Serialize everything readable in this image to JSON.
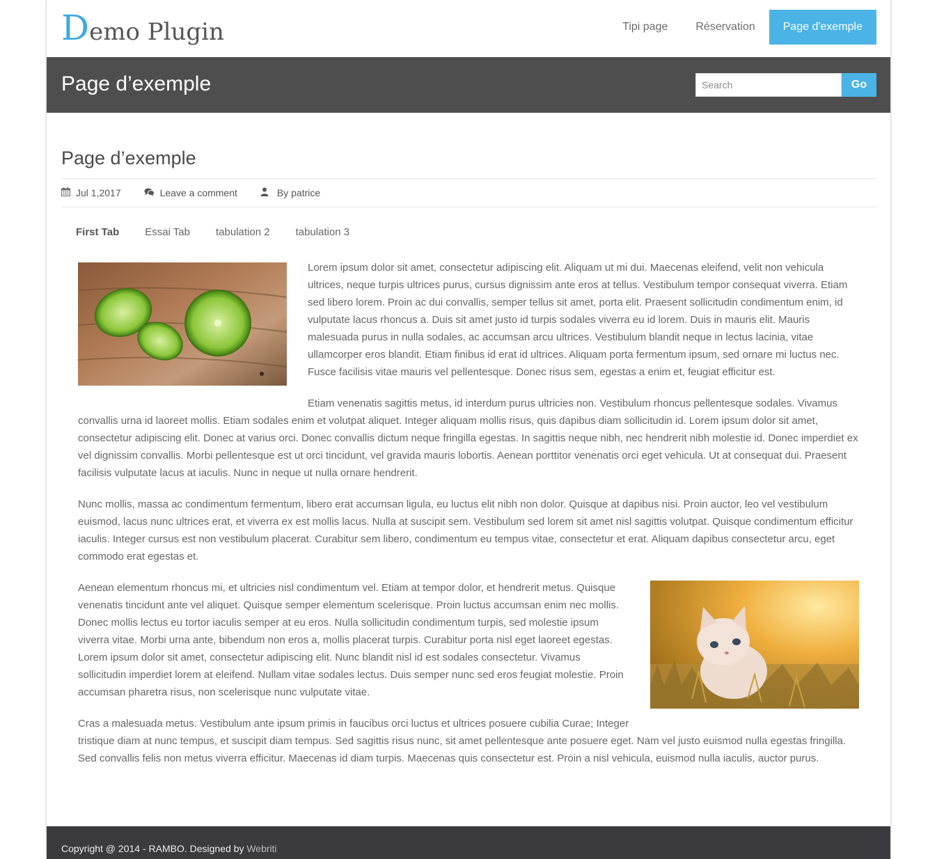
{
  "site": {
    "logo_initial": "D",
    "logo_rest": "emo Plugin",
    "nav": [
      {
        "label": "Tipi page"
      },
      {
        "label": "Réservation"
      },
      {
        "label": "Page d'exemple",
        "active": true
      }
    ]
  },
  "titlebar": {
    "title": "Page d’exemple",
    "search_placeholder": "Search",
    "search_button": "Go"
  },
  "post": {
    "title": "Page d’exemple",
    "date": "Jul 1,2017",
    "comment_link": "Leave a comment",
    "author": "By patrice",
    "tabs": [
      "First Tab",
      "Essai Tab",
      "tabulation 2",
      "tabulation 3"
    ],
    "paragraphs": [
      "Lorem ipsum dolor sit amet, consectetur adipiscing elit. Aliquam ut mi dui. Maecenas eleifend, velit non vehicula ultrices, neque turpis ultrices purus, cursus dignissim ante eros at tellus. Vestibulum tempor consequat viverra. Etiam sed libero lorem. Proin ac dui convallis, semper tellus sit amet, porta elit. Praesent sollicitudin condimentum enim, id vulputate lacus rhoncus a. Duis sit amet justo id turpis sodales viverra eu id lorem. Duis in mauris elit. Mauris malesuada purus in nulla sodales, ac accumsan arcu ultrices. Vestibulum blandit neque in lectus lacinia, vitae ullamcorper eros blandit. Etiam finibus id erat id ultrices. Aliquam porta fermentum ipsum, sed ornare mi luctus nec. Fusce facilisis vitae mauris vel pellentesque. Donec risus sem, egestas a enim et, feugiat efficitur est.",
      "Etiam venenatis sagittis metus, id interdum purus ultricies non. Vestibulum rhoncus pellentesque sodales. Vivamus convallis urna id laoreet mollis. Etiam sodales enim et volutpat aliquet. Integer aliquam mollis risus, quis dapibus diam sollicitudin id. Lorem ipsum dolor sit amet, consectetur adipiscing elit. Donec at varius orci. Donec convallis dictum neque fringilla egestas. In sagittis neque nibh, nec hendrerit nibh molestie id. Donec imperdiet ex vel dignissim convallis. Morbi pellentesque est ut orci tincidunt, vel gravida mauris lobortis. Aenean porttitor venenatis orci eget vehicula. Ut at consequat dui. Praesent facilisis vulputate lacus at iaculis. Nunc in neque ut nulla ornare hendrerit.",
      "Nunc mollis, massa ac condimentum fermentum, libero erat accumsan ligula, eu luctus elit nibh non dolor. Quisque at dapibus nisi. Proin auctor, leo vel vestibulum euismod, lacus nunc ultrices erat, et viverra ex est mollis lacus. Nulla at suscipit sem. Vestibulum sed lorem sit amet nisl sagittis volutpat. Quisque condimentum efficitur iaculis. Integer cursus est non vestibulum placerat. Curabitur sem libero, condimentum eu tempus vitae, consectetur et erat. Aliquam dapibus consectetur arcu, eget commodo erat egestas et.",
      "Aenean elementum rhoncus mi, et ultricies nisl condimentum vel. Etiam at tempor dolor, et hendrerit metus. Quisque venenatis tincidunt ante vel aliquet. Quisque semper elementum scelerisque. Proin luctus accumsan enim nec mollis. Donec mollis lectus eu tortor iaculis semper at eu eros. Nulla sollicitudin condimentum turpis, sed molestie ipsum viverra vitae. Morbi urna ante, bibendum non eros a, mollis placerat turpis. Curabitur porta nisl eget laoreet egestas. Lorem ipsum dolor sit amet, consectetur adipiscing elit. Nunc blandit nisl id est sodales consectetur. Vivamus sollicitudin imperdiet lorem at eleifend. Nullam vitae sodales lectus. Duis semper nunc sed eros feugiat molestie. Proin accumsan pharetra risus, non scelerisque nunc vulputate vitae.",
      "Cras a malesuada metus. Vestibulum ante ipsum primis in faucibus orci luctus et ultrices posuere cubilia Curae; Integer tristique diam at nunc tempus, et suscipit diam tempus. Sed sagittis risus nunc, sit amet pellentesque ante posuere eget. Nam vel justo euismod nulla egestas fringilla. Sed convallis felis non metus viverra efficitur. Maecenas id diam turpis. Maecenas quis consectetur est. Proin a nisl vehicula, euismod nulla iaculis, auctor purus."
    ]
  },
  "footer": {
    "copyright": "Copyright @ 2014 - RAMBO. Designed by ",
    "designer": "Webriti"
  },
  "colors": {
    "accent": "#4bb3e6",
    "titlebar_bg": "#4e4e4e",
    "footer_bg": "#3b3b3d"
  },
  "icons": {
    "date": "calendar-icon",
    "comment": "comments-icon",
    "author": "user-icon"
  }
}
